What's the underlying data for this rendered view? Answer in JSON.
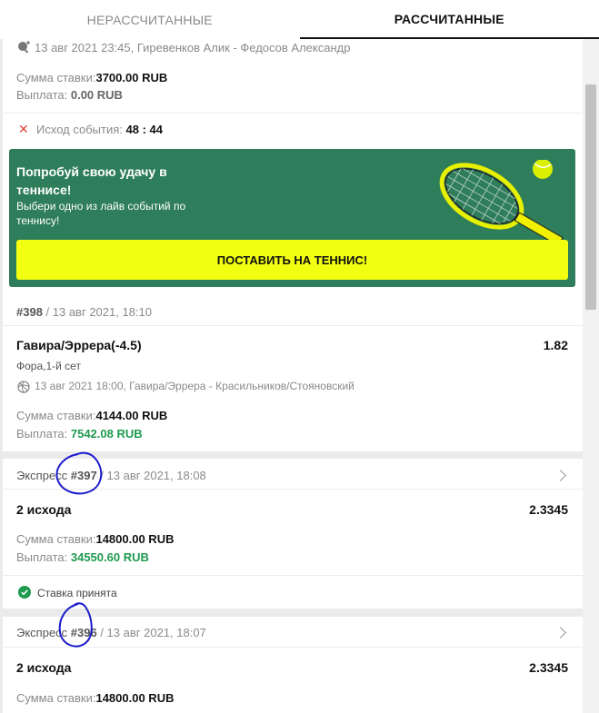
{
  "tabs": {
    "unsettled": "НЕРАССЧИТАННЫЕ",
    "settled": "РАССЧИТАННЫЕ"
  },
  "bet_top": {
    "event_line": "13 авг 2021 23:45, Гиревенков Алик - Федосов Александр",
    "stake_label": "Сумма ставки:",
    "stake_value": "3700.00 RUB",
    "payout_label": "Выплата:",
    "payout_value": "0.00 RUB",
    "outcome_label": "Исход события:",
    "outcome_score": "48 : 44"
  },
  "promo": {
    "title": "Попробуй свою удачу в теннисе!",
    "subtitle": "Выбери одно из лайв событий по теннису!",
    "button": "ПОСТАВИТЬ НА ТЕННИС!"
  },
  "bet_398": {
    "number": "#398",
    "date": " / 13 авг 2021, 18:10",
    "selection": "Гавира/Эррера(-4.5)",
    "odds": "1.82",
    "market": "Фора,1-й сет",
    "event_line": "13 авг 2021 18:00, Гавира/Эррера - Красильников/Стояновский",
    "stake_label": "Сумма ставки:",
    "stake_value": "4144.00 RUB",
    "payout_label": "Выплата:",
    "payout_value": "7542.08 RUB"
  },
  "bet_397": {
    "type": "Экспресс ",
    "number": "#397",
    "date": " / 13 авг 2021, 18:08",
    "outcomes": "2 исхода",
    "odds": "2.3345",
    "stake_label": "Сумма ставки:",
    "stake_value": "14800.00 RUB",
    "payout_label": "Выплата:",
    "payout_value": "34550.60 RUB",
    "status": "Ставка принята"
  },
  "bet_396": {
    "type": "Экспресс ",
    "number": "#396",
    "date": " / 13 авг 2021, 18:07",
    "outcomes": "2 исхода",
    "odds": "2.3345",
    "stake_label": "Сумма ставки:",
    "stake_value": "14800.00 RUB"
  },
  "colors": {
    "accent_green": "#1e9a4f",
    "promo_bg": "#2e7d5b",
    "promo_button": "#f3ff10",
    "loss_red": "#e0453a",
    "annotation_ink": "#1a1acc"
  },
  "icons": [
    "table-tennis-icon",
    "close-icon",
    "tennis-racket-icon",
    "tennis-ball-icon",
    "volleyball-icon",
    "chevron-right-icon",
    "check-circle-icon"
  ]
}
